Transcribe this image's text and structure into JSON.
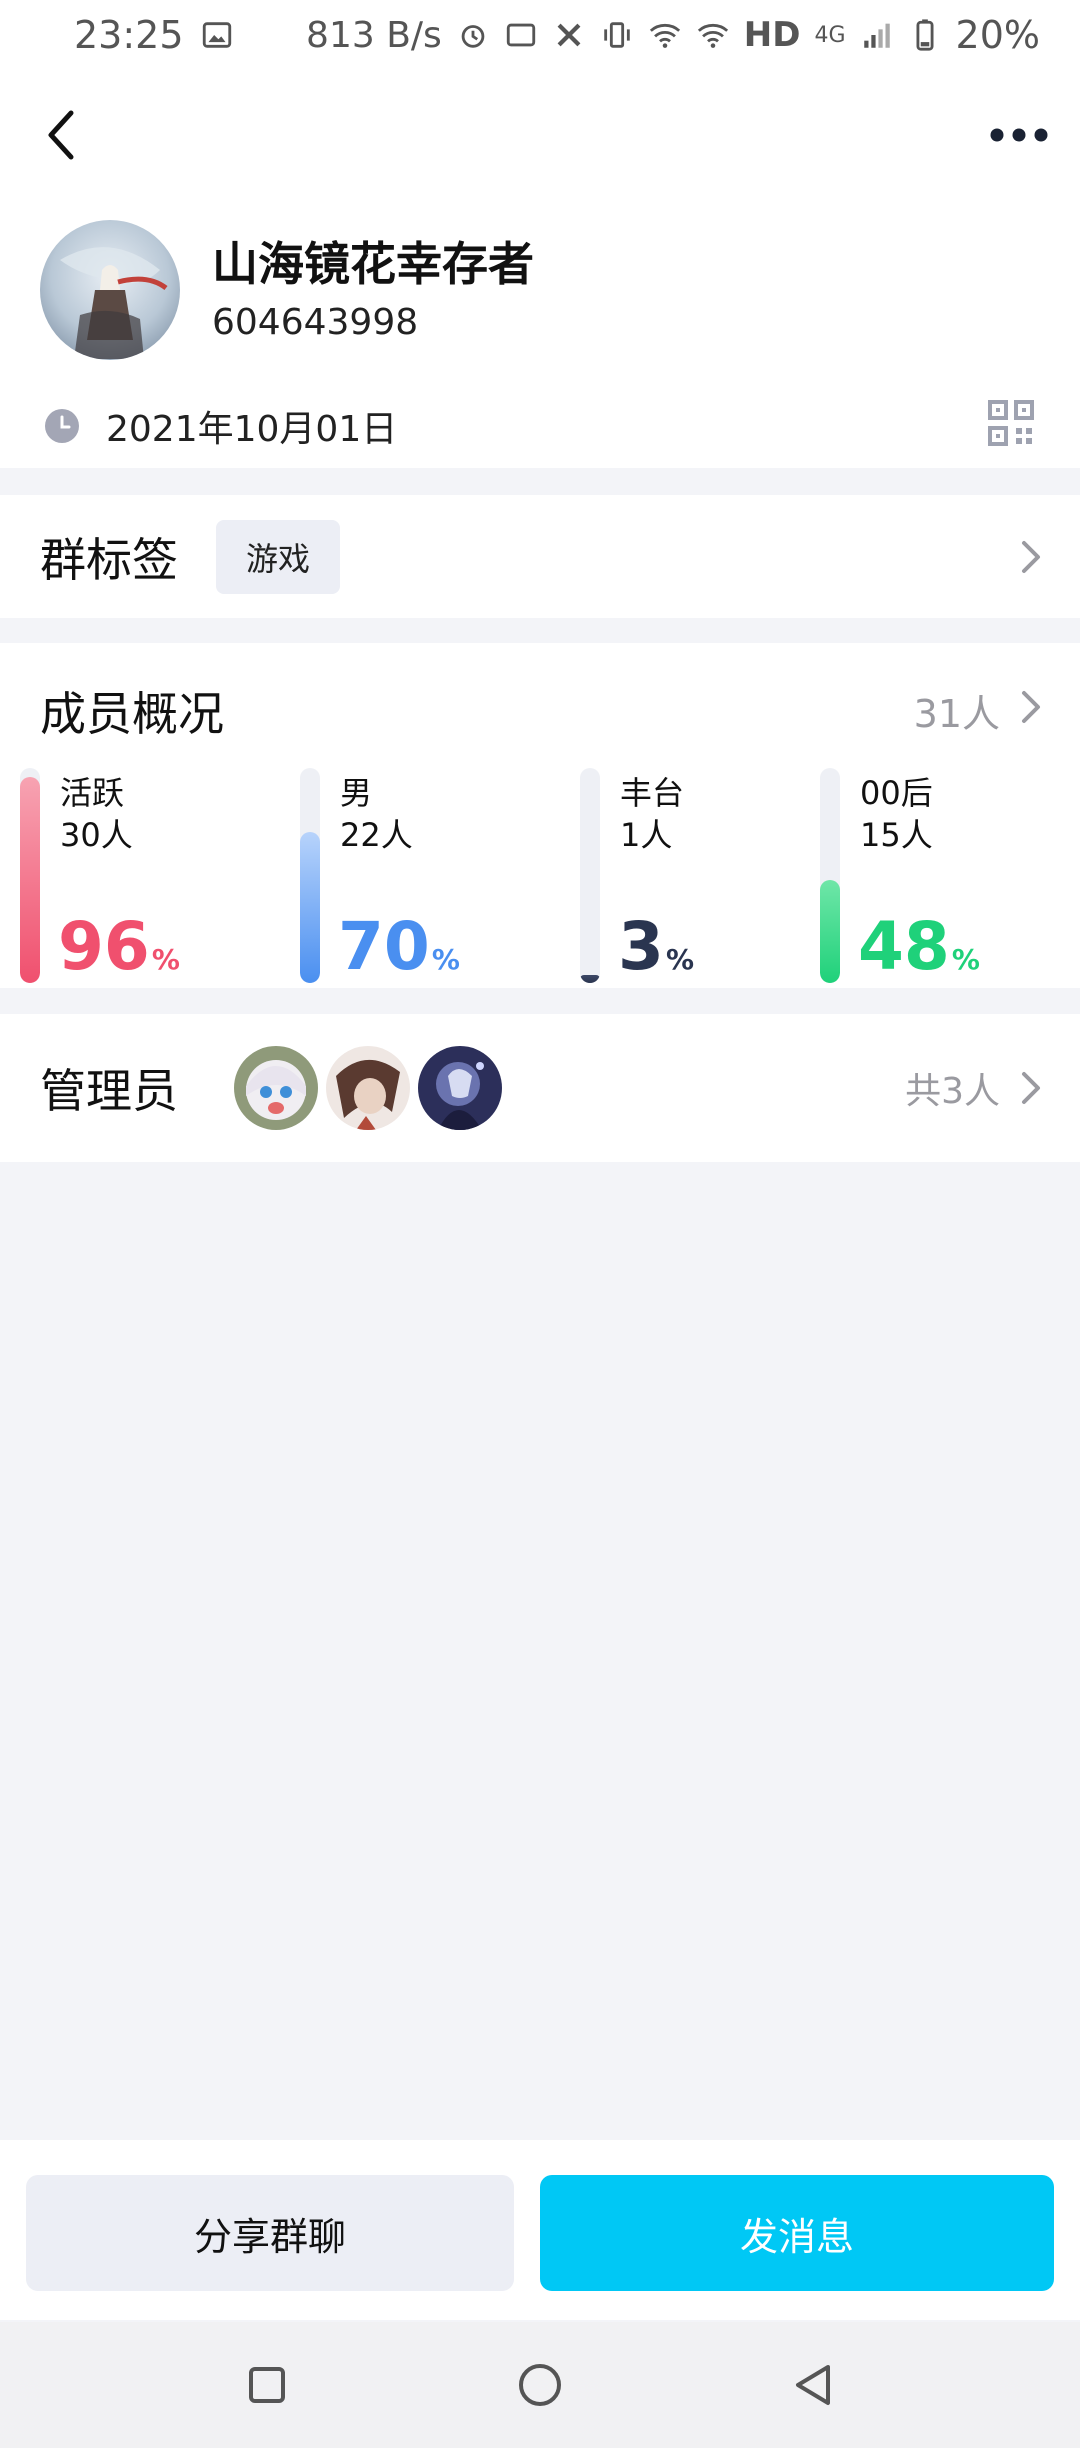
{
  "status_bar": {
    "time": "23:25",
    "net_speed": "813 B/s",
    "network": "HD",
    "network_gen": "4G",
    "battery": "20%"
  },
  "group": {
    "name": "山海镜花幸存者",
    "id": "604643998",
    "created_date": "2021年10月01日"
  },
  "tags": {
    "title": "群标签",
    "items": [
      "游戏"
    ]
  },
  "members": {
    "title": "成员概况",
    "total": "31人",
    "stats": [
      {
        "label": "活跃",
        "count": "30人",
        "percent": "96",
        "unit": "%",
        "fraction": 0.96,
        "color": "#f0506e",
        "fill_top": "#f7a3b2",
        "fill_bottom": "#f0506e"
      },
      {
        "label": "男",
        "count": "22人",
        "percent": "70",
        "unit": "%",
        "fraction": 0.7,
        "color": "#4a8ff0",
        "fill_top": "#b7d3fb",
        "fill_bottom": "#4a8ff0"
      },
      {
        "label": "丰台",
        "count": "1人",
        "percent": "3",
        "unit": "%",
        "fraction": 0.03,
        "color": "#2a3550",
        "fill_top": "#3c4766",
        "fill_bottom": "#2a3550"
      },
      {
        "label": "00后",
        "count": "15人",
        "percent": "48",
        "unit": "%",
        "fraction": 0.48,
        "color": "#1fd17a",
        "fill_top": "#6fe6a8",
        "fill_bottom": "#1fd17a"
      }
    ]
  },
  "admins": {
    "title": "管理员",
    "total": "共3人"
  },
  "actions": {
    "share_label": "分享群聊",
    "send_label": "发消息"
  },
  "colors": {
    "accent": "#00c8f5",
    "background": "#f3f4f8"
  }
}
